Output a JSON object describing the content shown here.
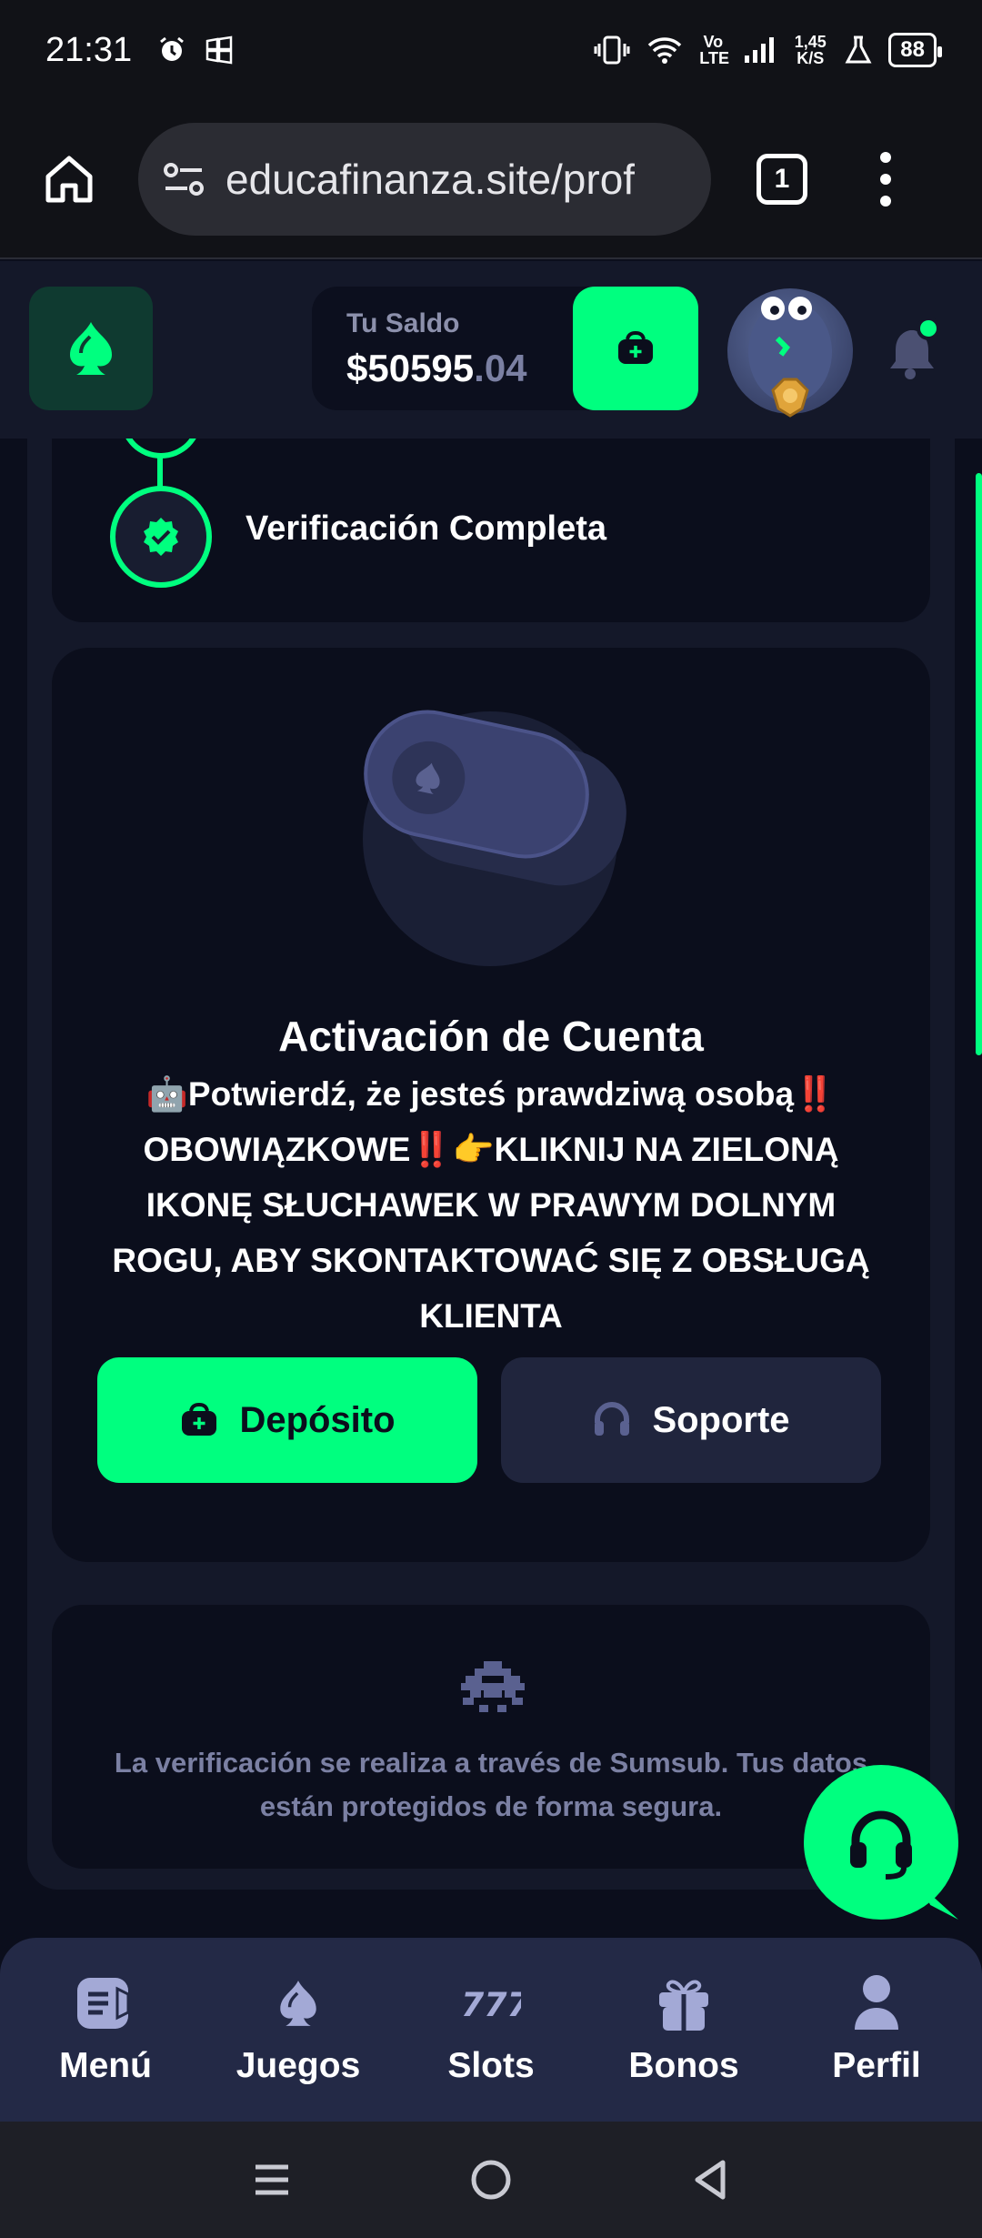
{
  "status_bar": {
    "time": "21:31",
    "network": "Vo LTE",
    "speed": "1,45 K/S",
    "battery": "88"
  },
  "browser": {
    "url": "educafinanza.site/prof",
    "tab_count": "1"
  },
  "header": {
    "balance_label": "Tu Saldo",
    "balance_whole": "$50595",
    "balance_cents": ".04"
  },
  "verification": {
    "step_title": "Verificación Completa"
  },
  "activation": {
    "title": "Activación de Cuenta",
    "message": "🤖Potwierdź, że jesteś prawdziwą osobą‼️ OBOWIĄZKOWE‼️👉KLIKNIJ NA ZIELONĄ IKONĘ SŁUCHAWEK W PRAWYM DOLNYM ROGU, ABY SKONTAKTOWAĆ SIĘ Z OBSŁUGĄ KLIENTA",
    "deposit_label": "Depósito",
    "support_label": "Soporte"
  },
  "sumsub": {
    "text": "La verificación se realiza a través de Sumsub. Tus datos están protegidos de forma segura."
  },
  "bottom_nav": {
    "items": [
      {
        "label": "Menú",
        "icon": "menu-icon"
      },
      {
        "label": "Juegos",
        "icon": "spade-icon"
      },
      {
        "label": "Slots",
        "icon": "slots-777-icon"
      },
      {
        "label": "Bonos",
        "icon": "gift-icon"
      },
      {
        "label": "Perfil",
        "icon": "user-icon"
      }
    ]
  },
  "colors": {
    "accent": "#00ff7f",
    "background": "#0b0e1c",
    "panel": "#141829",
    "muted_text": "#7b80a3"
  }
}
